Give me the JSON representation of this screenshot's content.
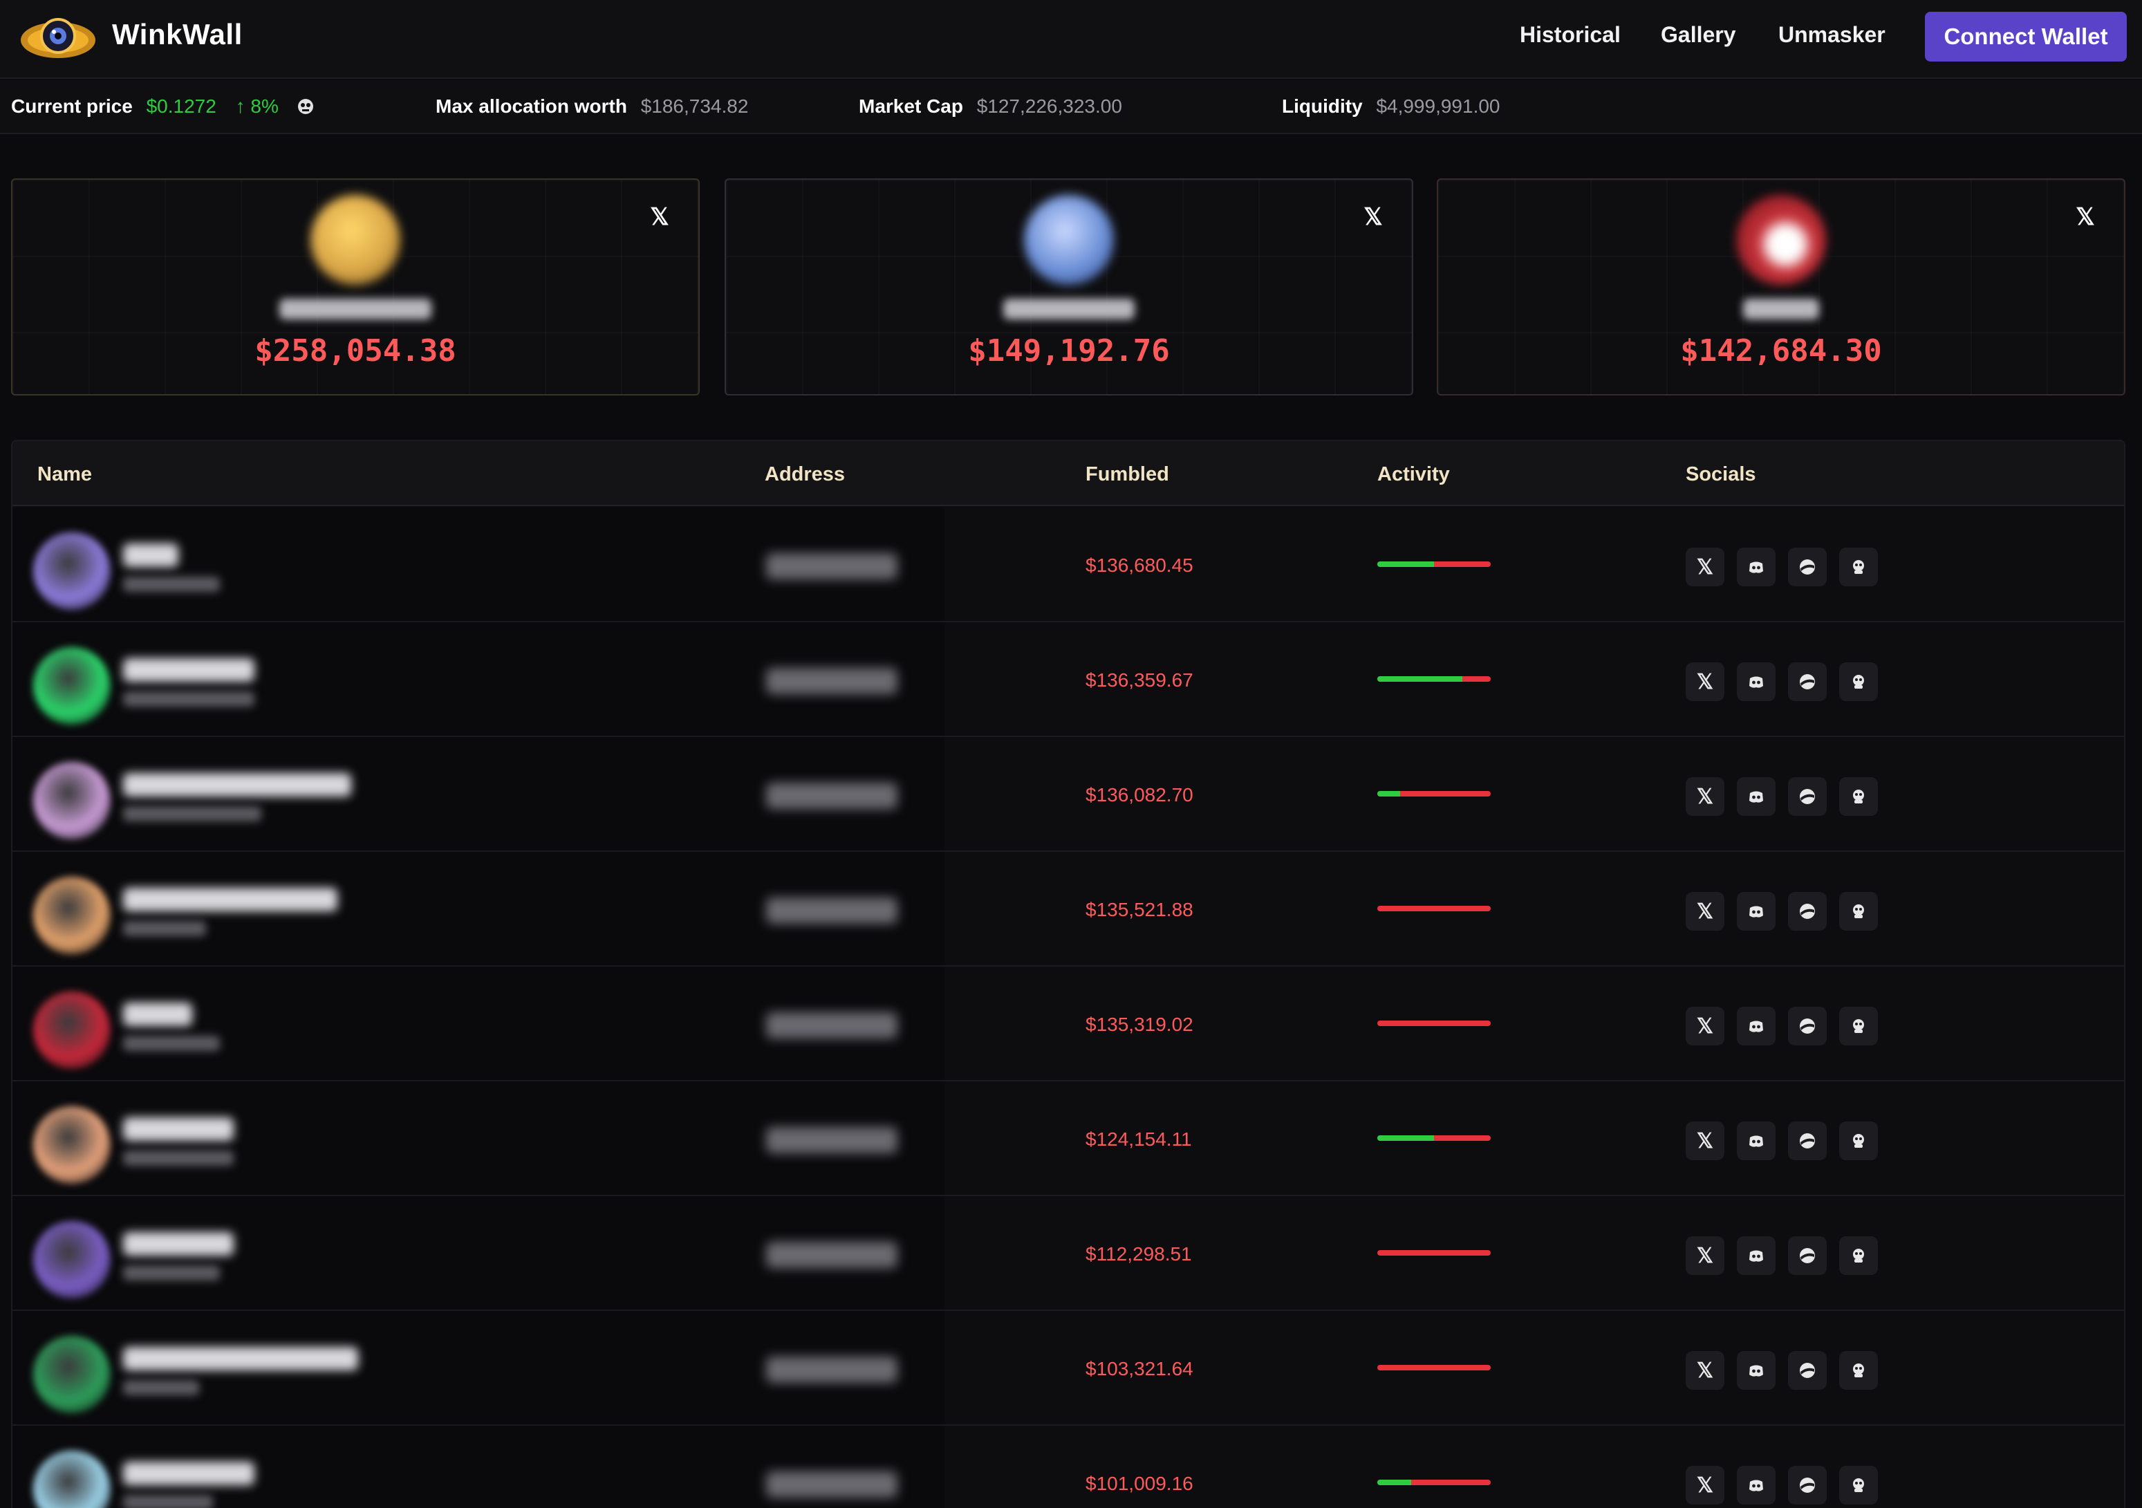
{
  "header": {
    "brand": "WinkWall",
    "nav": [
      "Historical",
      "Gallery",
      "Unmasker"
    ],
    "connect_label": "Connect Wallet"
  },
  "stats": {
    "current_price_label": "Current price",
    "current_price_value": "$0.1272",
    "price_change": "8%",
    "max_alloc_label": "Max allocation worth",
    "max_alloc_value": "$186,734.82",
    "market_cap_label": "Market Cap",
    "market_cap_value": "$127,226,323.00",
    "liquidity_label": "Liquidity",
    "liquidity_value": "$4,999,991.00"
  },
  "top_cards": [
    {
      "value": "$258,054.38",
      "avatar_color": "#d9a647"
    },
    {
      "value": "$149,192.76",
      "avatar_color": "#6b8fd6"
    },
    {
      "value": "$142,684.30",
      "avatar_color": "#c8323a"
    }
  ],
  "table": {
    "headers": [
      "Name",
      "Address",
      "Fumbled",
      "Activity",
      "Socials"
    ],
    "rows": [
      {
        "fumbled": "$136,680.45",
        "activity_green": 0.5,
        "avatar_color": "#8c7ad9"
      },
      {
        "fumbled": "$136,359.67",
        "activity_green": 0.75,
        "avatar_color": "#2bd36a"
      },
      {
        "fumbled": "$136,082.70",
        "activity_green": 0.2,
        "avatar_color": "#c79bd4"
      },
      {
        "fumbled": "$135,521.88",
        "activity_green": 0.0,
        "avatar_color": "#e0a06a"
      },
      {
        "fumbled": "$135,319.02",
        "activity_green": 0.0,
        "avatar_color": "#c4283a"
      },
      {
        "fumbled": "$124,154.11",
        "activity_green": 0.5,
        "avatar_color": "#e3a07a"
      },
      {
        "fumbled": "$112,298.51",
        "activity_green": 0.0,
        "avatar_color": "#7a5ec4"
      },
      {
        "fumbled": "$103,321.64",
        "activity_green": 0.0,
        "avatar_color": "#2d9d5a"
      },
      {
        "fumbled": "$101,009.16",
        "activity_green": 0.3,
        "avatar_color": "#9ad0e6"
      }
    ]
  },
  "colors": {
    "accent": "#5b43c9",
    "loss_red": "#ff5a5a",
    "gain_green": "#2ecc40",
    "header_text": "#f1e4c4"
  },
  "icons": {
    "social": [
      "x-icon",
      "discord-icon",
      "globe-icon",
      "telegram-icon"
    ]
  }
}
